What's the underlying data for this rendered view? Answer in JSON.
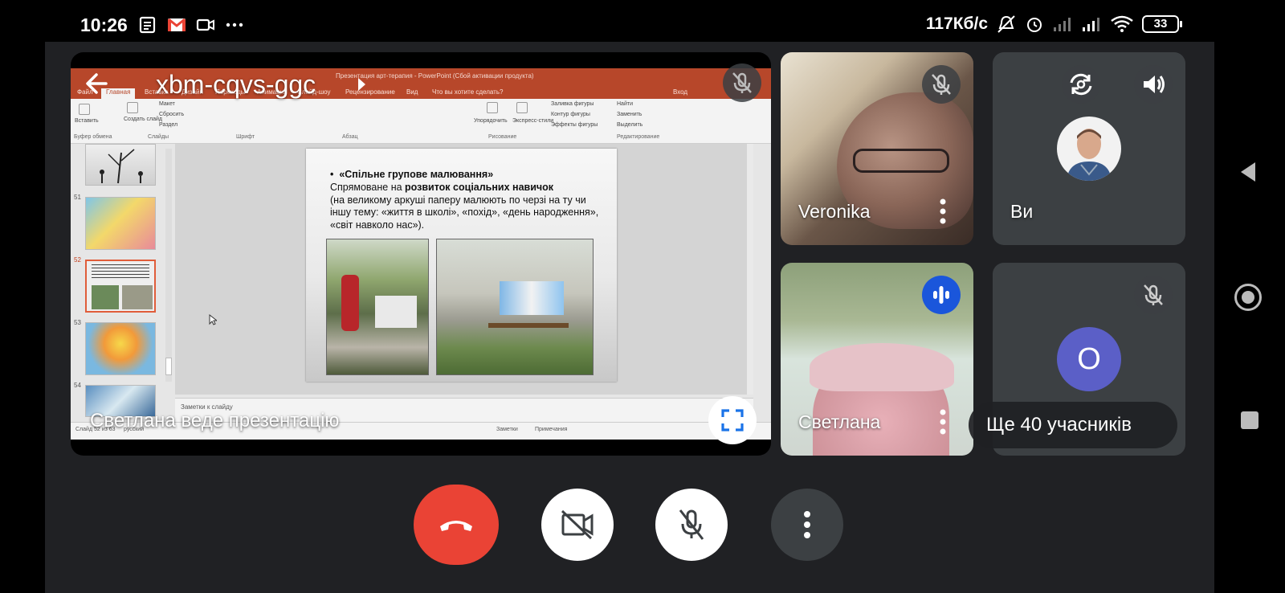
{
  "status_bar": {
    "time": "10:26",
    "network_speed": "117Кб/с",
    "battery": "33",
    "icons": [
      "notes-icon",
      "gmail-icon",
      "video-icon",
      "more-dots-icon",
      "bell-muted-icon",
      "alarm-icon",
      "signal-icon",
      "signal-icon",
      "wifi-icon",
      "battery-icon"
    ]
  },
  "meeting": {
    "code": "xbm-cqvs-ggc",
    "presenter_caption": "Светлана веде презентацію"
  },
  "powerpoint": {
    "title": "Презентация арт-терапия - PowerPoint (Сбой активации продукта)",
    "tabs": [
      "Файл",
      "Главная",
      "Вставка",
      "Дизайн",
      "Переходы",
      "Анимация",
      "Слайд-шоу",
      "Рецензирование",
      "Вид",
      "Что вы хотите сделать?",
      "Вход"
    ],
    "ribbon_groups": [
      "Буфер обмена",
      "Слайды",
      "Шрифт",
      "Абзац",
      "Рисование",
      "Редактирование"
    ],
    "ribbon_items": [
      "Вставить",
      "Создать слайд",
      "Макет",
      "Сбросить",
      "Раздел",
      "Упорядочить",
      "Экспресс-стили",
      "Заливка фигуры",
      "Контур фигуры",
      "Эффекты фигуры",
      "Найти",
      "Заменить",
      "Выделить"
    ],
    "thumb_numbers": [
      "51",
      "52",
      "53",
      "54"
    ],
    "notes_placeholder": "Заметки к слайду",
    "status_slide": "Слайд 52 из 63",
    "status_lang": "русский",
    "status_notes": "Заметки",
    "status_comments": "Примечания",
    "slide": {
      "bullet_title": "«Спільне групове малювання»",
      "line1_prefix": "Спрямоване на ",
      "line1_bold": "розвиток соціальних навичок",
      "line2": "(на великому аркуші паперу малюють по черзі на ту чи іншу тему: «життя в школі», «похід», «день народження», «світ навколо нас»)."
    }
  },
  "participants": [
    {
      "name": "Veronika",
      "muted": true
    },
    {
      "name": "Ви",
      "muted": false
    },
    {
      "name": "Светлана",
      "speaking": true
    },
    {
      "name": "O",
      "muted": true
    }
  ],
  "more_participants": "Ще 40 учасників",
  "controls": {
    "end_call": "end-call",
    "camera": "camera-off",
    "mic": "mic-off",
    "more": "more-options"
  },
  "colors": {
    "end_call": "#ea4335",
    "speaking": "#1a56db",
    "avatar_o": "#5b5fc7",
    "ppt_accent": "#b7472a"
  }
}
